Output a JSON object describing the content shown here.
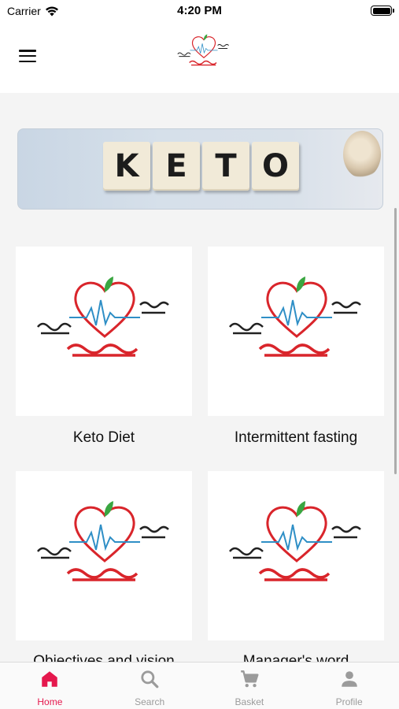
{
  "status_bar": {
    "carrier": "Carrier",
    "time": "4:20 PM"
  },
  "header": {
    "menu_icon": "hamburger-menu-icon",
    "logo": "keto-hammad-logo"
  },
  "banner": {
    "tiles": [
      "K",
      "E",
      "T",
      "O"
    ]
  },
  "cards": [
    {
      "title": "Keto Diet",
      "image": "keto-hammad-logo"
    },
    {
      "title": "Intermittent fasting",
      "image": "keto-hammad-logo"
    },
    {
      "title": "Objectives and vision",
      "image": "keto-hammad-logo"
    },
    {
      "title": "Manager's word",
      "image": "keto-hammad-logo"
    }
  ],
  "tabs": [
    {
      "label": "Home",
      "icon": "home-icon",
      "active": true
    },
    {
      "label": "Search",
      "icon": "search-icon",
      "active": false
    },
    {
      "label": "Basket",
      "icon": "cart-icon",
      "active": false
    },
    {
      "label": "Profile",
      "icon": "person-icon",
      "active": false
    }
  ],
  "colors": {
    "accent": "#e5184d",
    "logo_red": "#d9252b",
    "logo_green": "#3aa641",
    "logo_pulse": "#2f8fc6",
    "tab_inactive": "#9b9b9b"
  }
}
